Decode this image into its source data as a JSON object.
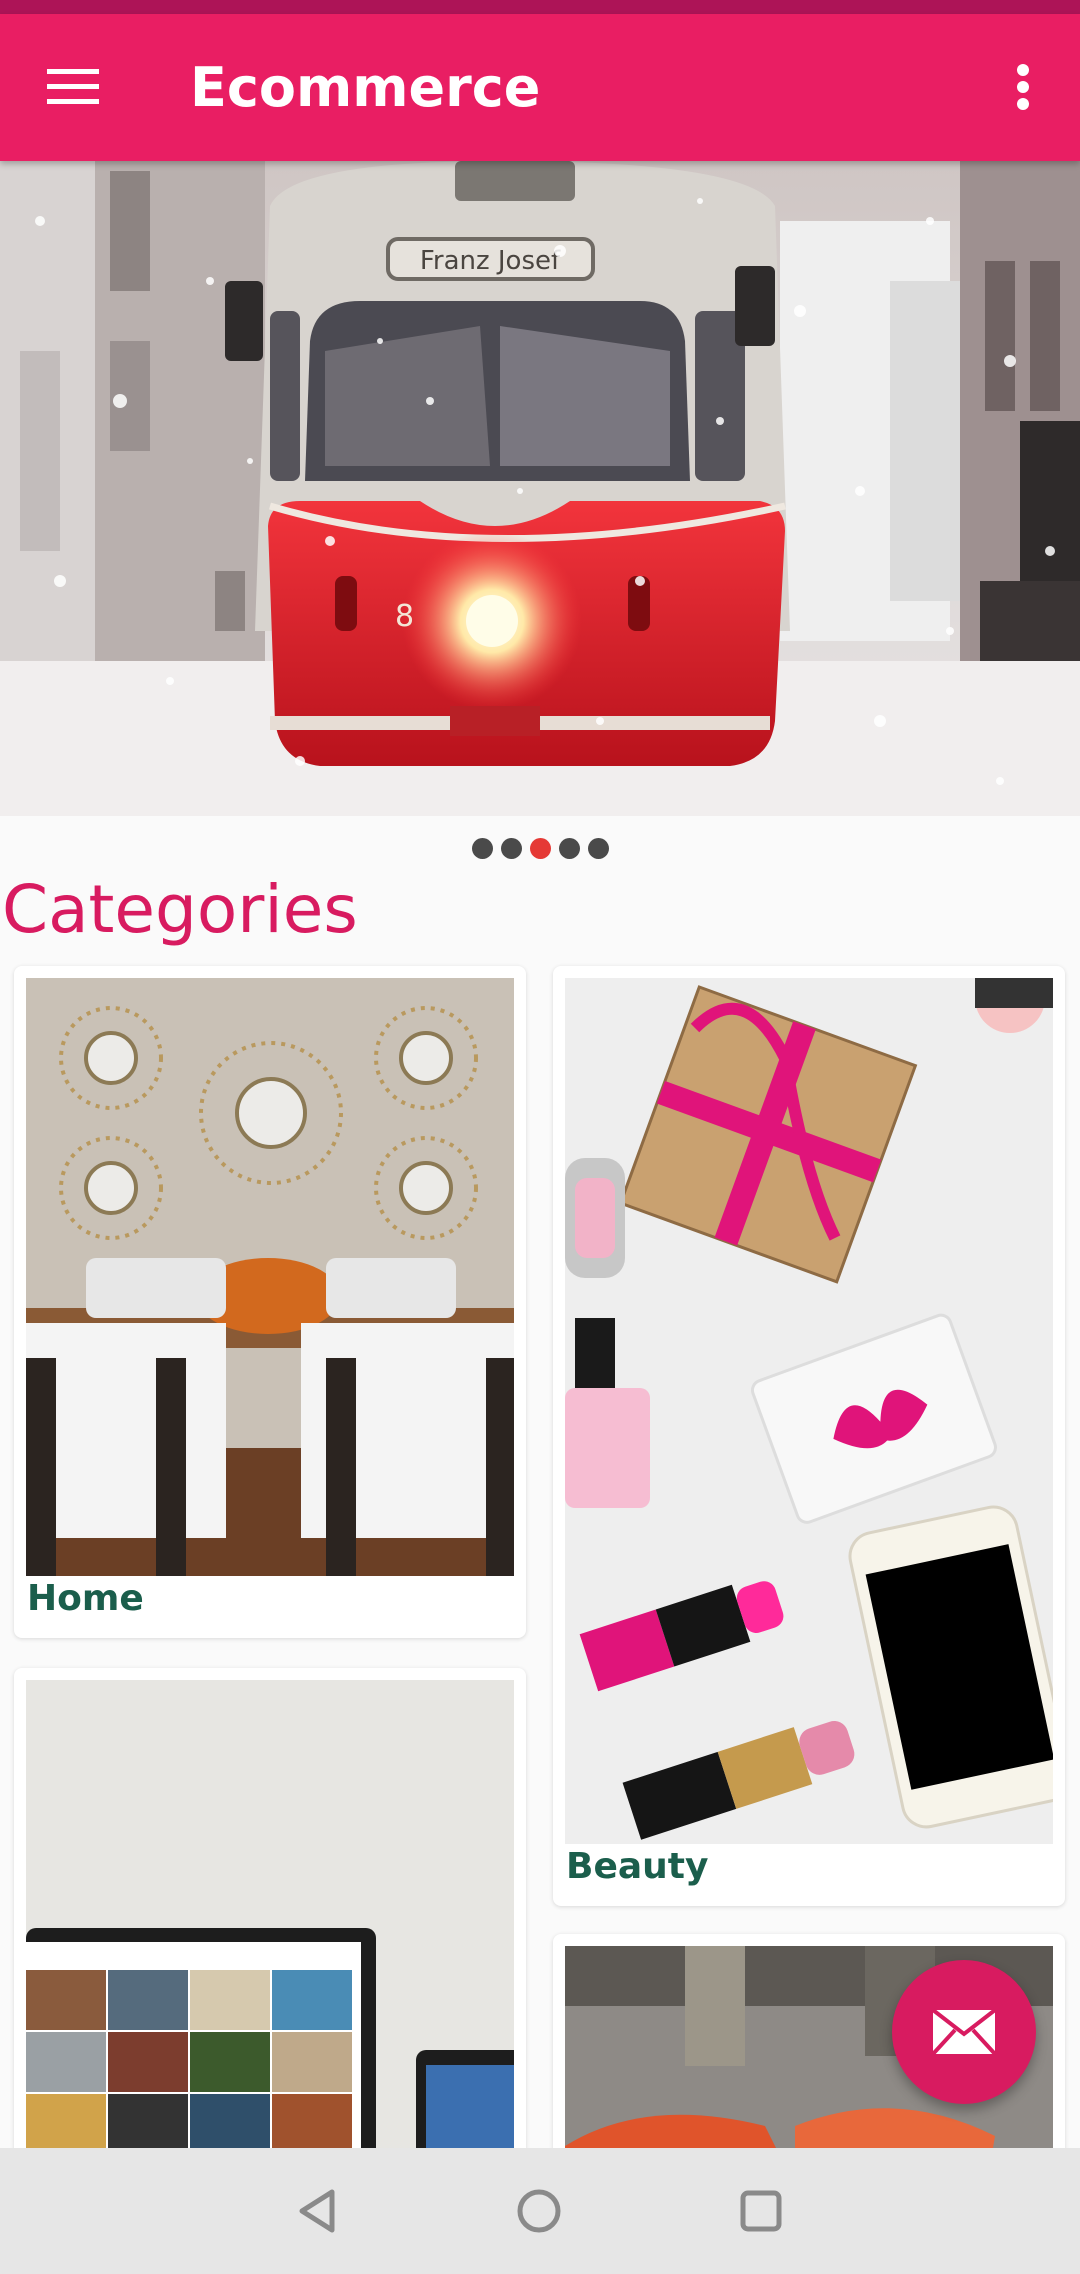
{
  "app_bar": {
    "title": "Ecommerce",
    "menu_icon": "hamburger-menu-icon",
    "overflow_icon": "more-vertical-icon",
    "color": "#E91E63"
  },
  "banner": {
    "image": "red-tram-in-snow",
    "tram_sign": "Franz Josef",
    "tram_number": "8",
    "slide_count": 5,
    "active_slide": 3
  },
  "categories": {
    "title": "Categories",
    "items": [
      {
        "label": "Home",
        "image": "living-room-mirrors-chairs"
      },
      {
        "label": "Beauty",
        "image": "cosmetics-gift-phone"
      },
      {
        "label": "",
        "image": "laptop-tablet-electronics"
      },
      {
        "label": "",
        "image": "shoes-fashion"
      }
    ]
  },
  "fab": {
    "icon": "mail-icon",
    "color": "#D81B60"
  },
  "nav_bar": {
    "back_icon": "back-icon",
    "home_icon": "home-circle-icon",
    "recents_icon": "recents-square-icon"
  }
}
